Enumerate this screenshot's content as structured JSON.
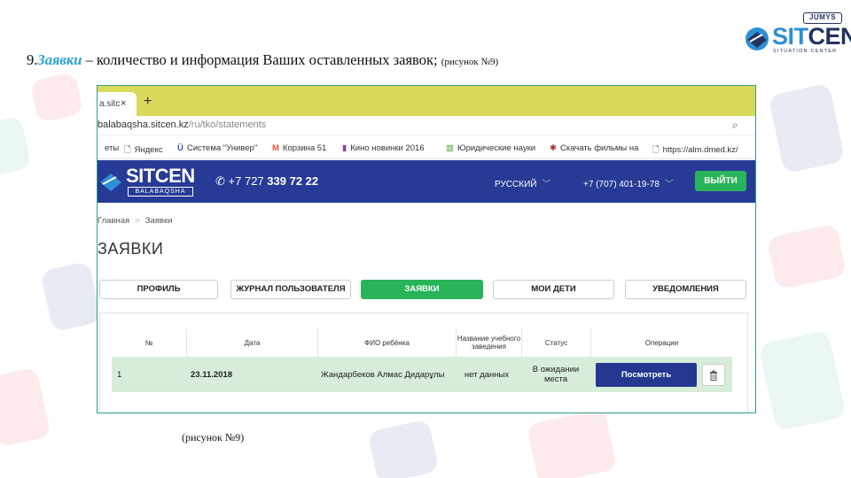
{
  "slide": {
    "heading_number": "9.",
    "heading_highlight": "Заявки",
    "heading_rest": " – количество и информация Ваших оставленных заявок; ",
    "heading_ref": "(рисунок №9)",
    "caption": "(рисунок №9)",
    "logo": {
      "badge": "JUMYS",
      "brand_a": "SIT",
      "brand_b": "CEN",
      "subtitle": "SITUATION CENTER"
    }
  },
  "browser": {
    "tab_title": "a.sitc",
    "tab_close": "×",
    "new_tab": "+",
    "url_host": "balabaqsha.sitcen.kz",
    "url_path": "/ru/tko/statements",
    "zoom_icon": "⌕",
    "bookmarks": [
      {
        "icon": "",
        "label": "еты"
      },
      {
        "icon": "🗋",
        "label": "Яндекс"
      },
      {
        "icon": "Ü",
        "label": "Система \"Универ\""
      },
      {
        "icon": "M",
        "label": "Корзина 51"
      },
      {
        "icon": "▮",
        "label": "Кино новинки 2016"
      },
      {
        "icon": "▥",
        "label": "Юридические науки"
      },
      {
        "icon": "✱",
        "label": "Скачать фильмы на"
      },
      {
        "icon": "🗋",
        "label": "https://alm.dmed.kz/"
      }
    ]
  },
  "site": {
    "logo_title": "SITCEN",
    "logo_sub": "BALABAQSHA",
    "phone_icon": "✆",
    "phone_prefix": "+7 727 ",
    "phone_main": "339 72 22",
    "language": "РУССКИЙ",
    "phone_secondary": "+7 (707) 401-19-78",
    "chevron": "﹀",
    "login_button": "ВЫЙТИ",
    "breadcrumb": {
      "home": "Главная",
      "sep": ">",
      "current": "Заявки"
    },
    "page_title": "ЗАЯВКИ",
    "nav_buttons": [
      "ПРОФИЛЬ",
      "ЖУРНАЛ ПОЛЬЗОВАТЕЛЯ",
      "ЗАЯВКИ",
      "МОИ ДЕТИ",
      "УВЕДОМЛЕНИЯ"
    ],
    "active_nav": "ЗАЯВКИ",
    "table": {
      "headers": [
        "№",
        "Дата",
        "ФИО ребёнка",
        "Название учебного заведения",
        "Статус",
        "Операции"
      ],
      "rows": [
        {
          "num": "1",
          "date": "23.11.2018",
          "child": "Жандарбеков Алмас Дидарұлы",
          "institution": "нет данных",
          "status": "В ожидании места",
          "view_button": "Посмотреть"
        }
      ]
    }
  },
  "colors": {
    "accent_blue": "#263a96",
    "accent_green": "#29b45a",
    "row_green": "#d7ecd9",
    "heading_highlight": "#2aa0dc"
  }
}
